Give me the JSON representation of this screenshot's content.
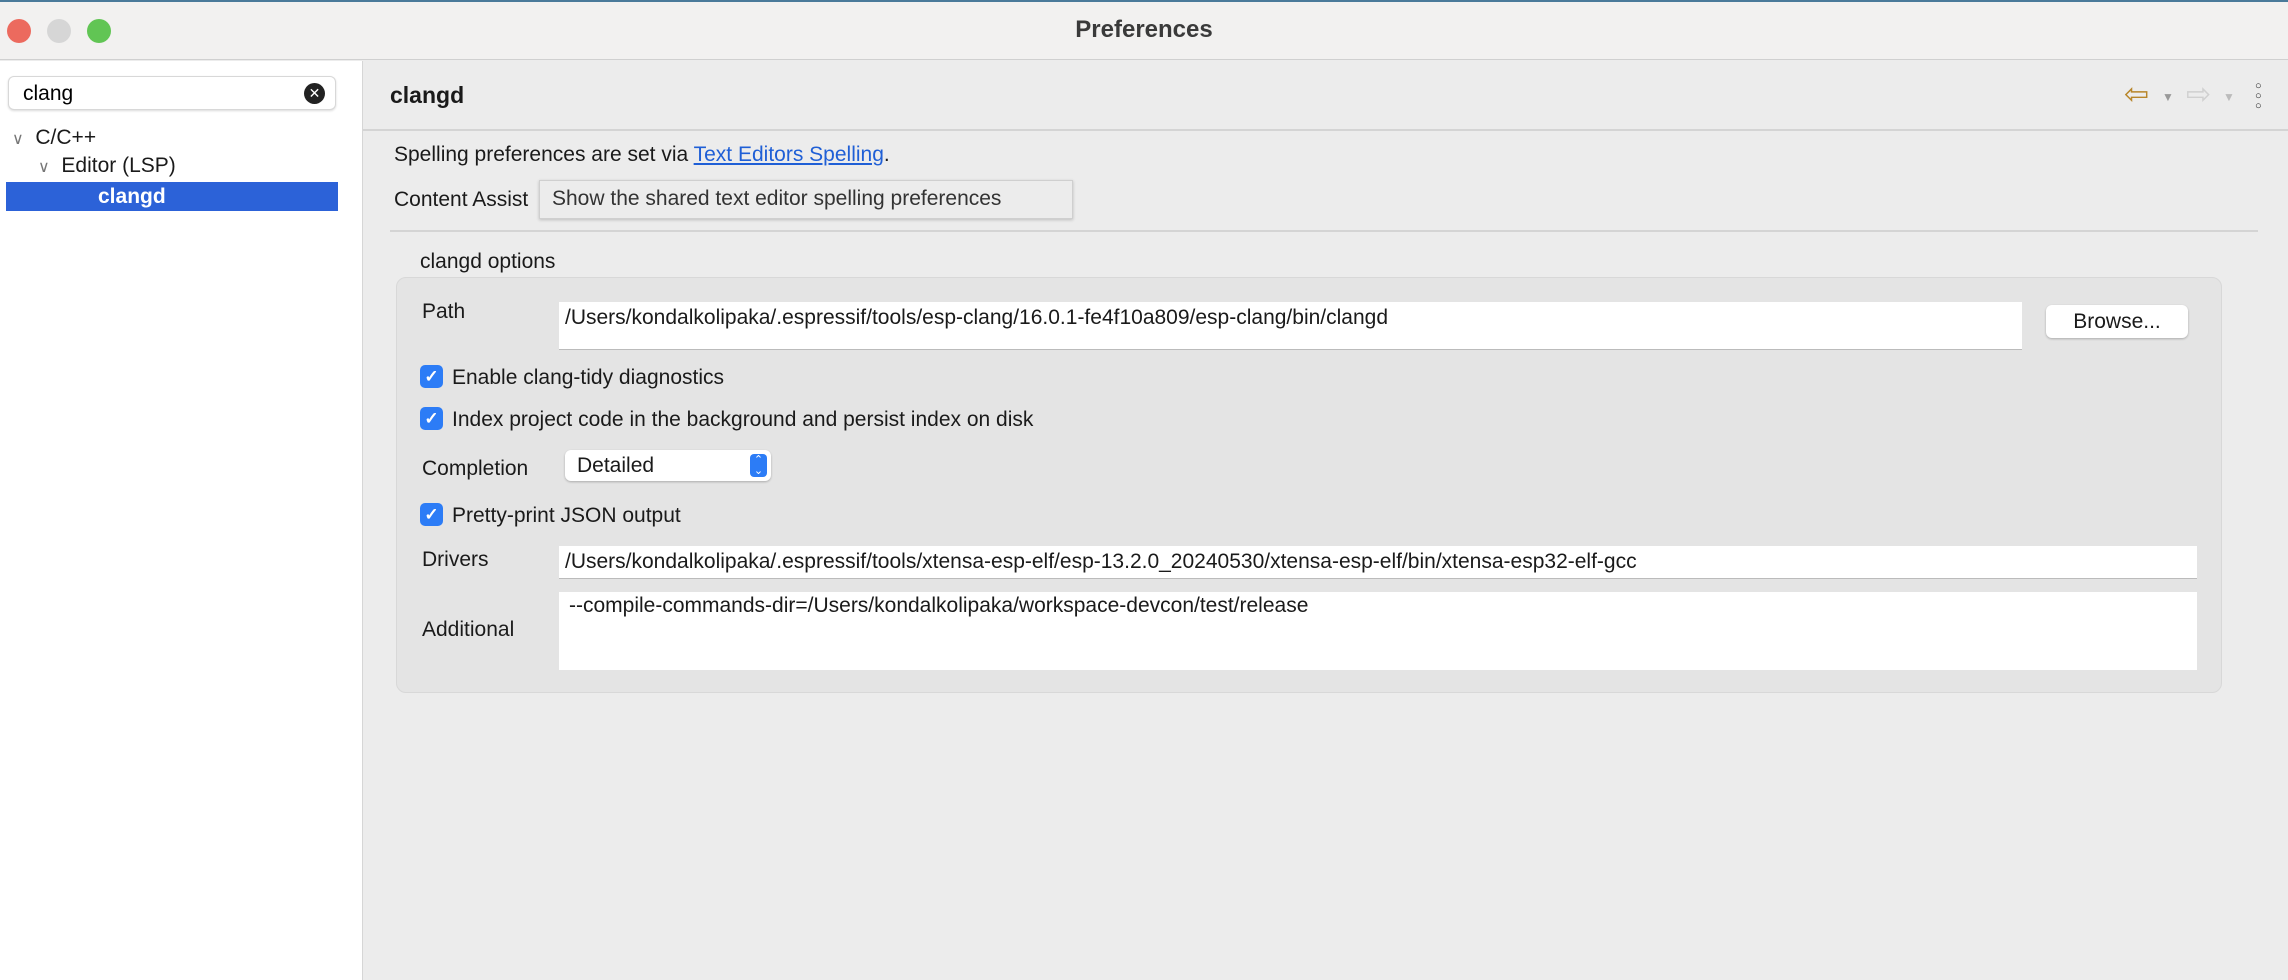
{
  "window": {
    "title": "Preferences"
  },
  "sidebar": {
    "search_value": "clang",
    "tree": [
      {
        "label": "C/C++"
      },
      {
        "label": "Editor (LSP)"
      },
      {
        "label": "clangd"
      }
    ]
  },
  "page": {
    "title": "clangd",
    "spelling_prefix": "Spelling preferences are set via ",
    "spelling_link": "Text Editors Spelling",
    "spelling_suffix": ".",
    "content_assist": "Content Assist",
    "tooltip": "Show the shared text editor spelling preferences"
  },
  "options": {
    "group_label": "clangd options",
    "path_label": "Path",
    "path_value": "/Users/kondalkolipaka/.espressif/tools/esp-clang/16.0.1-fe4f10a809/esp-clang/bin/clangd",
    "browse_label": "Browse...",
    "clang_tidy": {
      "label": "Enable clang-tidy diagnostics",
      "checked": true
    },
    "index": {
      "label": "Index project code in the background and persist index on disk",
      "checked": true
    },
    "completion_label": "Completion",
    "completion_value": "Detailed",
    "pretty": {
      "label": "Pretty-print JSON output",
      "checked": true
    },
    "drivers_label": "Drivers",
    "drivers_value": "/Users/kondalkolipaka/.espressif/tools/xtensa-esp-elf/esp-13.2.0_20240530/xtensa-esp-elf/bin/xtensa-esp32-elf-gcc",
    "additional_label": "Additional",
    "additional_value": "--compile-commands-dir=/Users/kondalkolipaka/workspace-devcon/test/release"
  },
  "colors": {
    "accent": "#2c62d8",
    "link": "#1f5fd6",
    "checkbox": "#2c7cf6"
  }
}
